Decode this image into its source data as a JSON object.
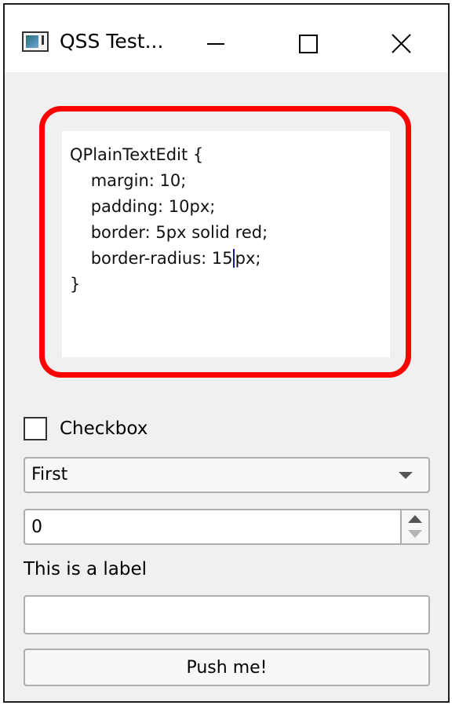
{
  "window": {
    "title": "QSS Test...",
    "controls": {
      "minimize_icon": "minimize-icon",
      "maximize_icon": "maximize-icon",
      "close_icon": "close-icon"
    }
  },
  "text_edit": {
    "lines": [
      "QPlainTextEdit {",
      "    margin: 10;",
      "    padding: 10px;",
      "    border: 5px solid red;",
      "    border-radius: 15",
      "}"
    ],
    "line5_after_caret": "px;",
    "border_color": "#ff0000"
  },
  "checkbox": {
    "label": "Checkbox"
  },
  "combo": {
    "selected": "First"
  },
  "spinbox": {
    "value": "0"
  },
  "label": {
    "text": "This is a label"
  },
  "line_edit": {
    "value": ""
  },
  "button": {
    "label": "Push me!"
  }
}
